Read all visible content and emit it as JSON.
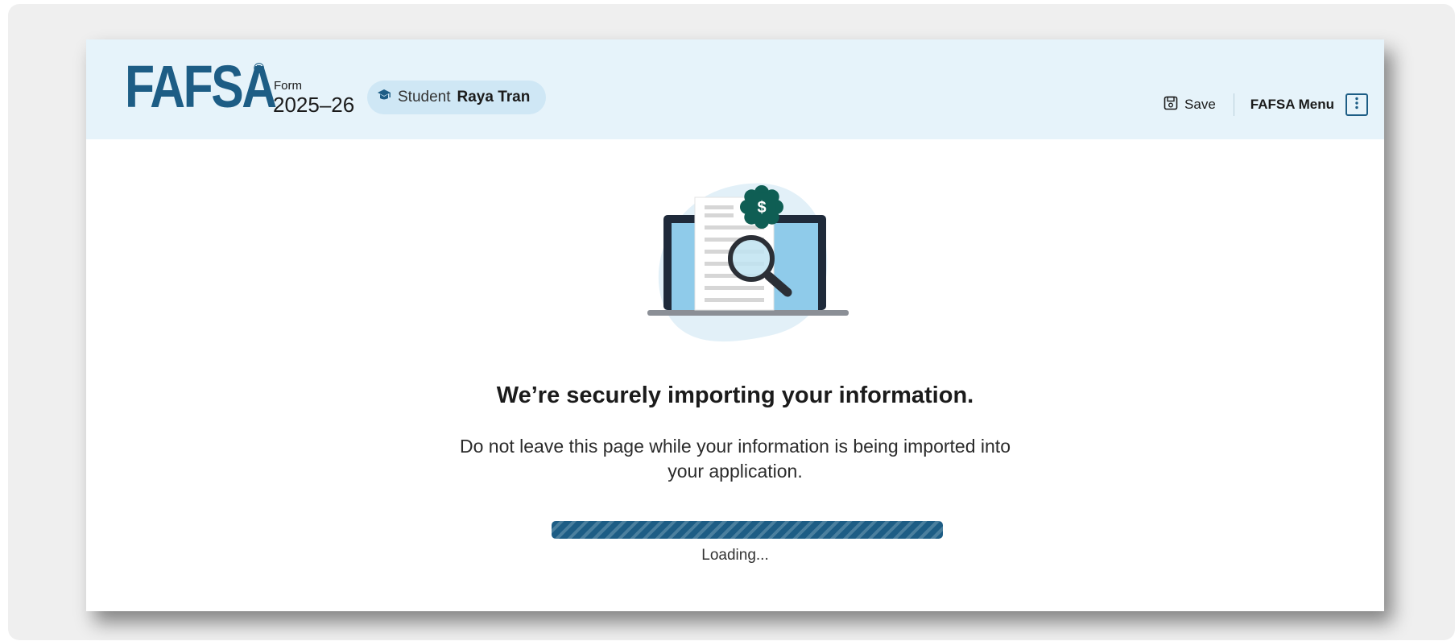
{
  "header": {
    "logo_text": "FAFSA",
    "logo_reg": "®",
    "form_label": "Form",
    "form_year": "2025–26",
    "student_prefix": "Student",
    "student_name": "Raya Tran",
    "save_label": "Save",
    "menu_label": "FAFSA Menu"
  },
  "main": {
    "heading": "We’re securely importing your information.",
    "subtext": "Do not leave this page while your information is being imported into your application.",
    "loading_label": "Loading...",
    "progress": 1.0
  },
  "icons": {
    "student": "graduation-cap-icon",
    "save": "save-icon",
    "menu": "vertical-dots-icon",
    "illustration": "laptop-document-magnifier-illustration"
  },
  "colors": {
    "brand": "#1d5d85",
    "header_bg": "#e6f3fa",
    "pill_bg": "#cfe7f5",
    "badge": "#0f5e54"
  }
}
